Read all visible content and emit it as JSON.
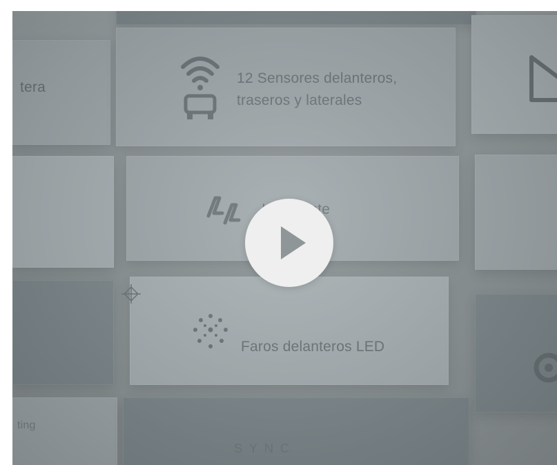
{
  "video": {
    "play_button_label": "Play"
  },
  "features": {
    "sensors_line1": "12 Sensores delanteros,",
    "sensors_line2": "traseros y laterales",
    "awd": "Inteligente",
    "led": "Faros delanteros LED",
    "sync": "SYNC"
  },
  "cutoff_labels": {
    "left_top": "tera",
    "left_bottom": "ting"
  },
  "icons": {
    "wifi_car": "wifi-car-icon",
    "four_by_four": "4x4-icon",
    "led_dots": "led-dots-icon",
    "crosshair": "crosshair-icon",
    "play": "play-icon"
  },
  "colors": {
    "overlay": "#8e9698",
    "panel": "#9fa8ab",
    "text": "#6b7478",
    "play_circle": "#efefef",
    "play_glyph": "#8e9698"
  }
}
